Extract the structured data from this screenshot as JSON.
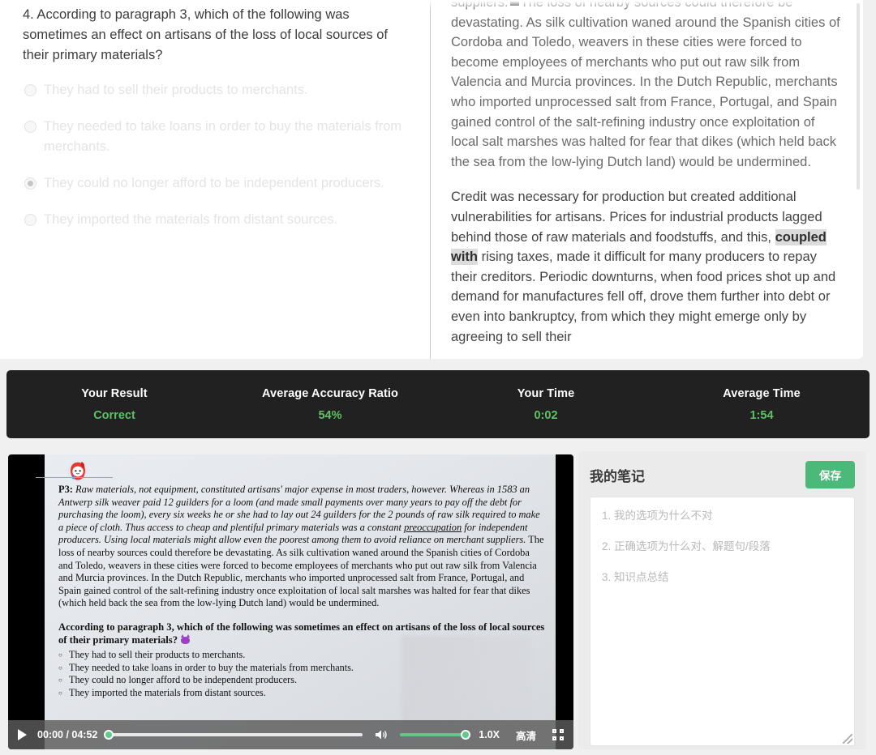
{
  "question": {
    "stem": "4. According to paragraph 3, which of the following was sometimes an effect on artisans of the loss of local sources of their primary materials?",
    "options": [
      {
        "text": "They had to sell their products to merchants.",
        "selected": false
      },
      {
        "text": "They needed to take loans in order to buy the materials from merchants.",
        "selected": false
      },
      {
        "text": "They could no longer afford to be independent producers.",
        "selected": true
      },
      {
        "text": "They imported the materials from distant sources.",
        "selected": false
      }
    ]
  },
  "passage": {
    "para1_pre": "suppliers.",
    "para1_post": "The loss of nearby sources could therefore be devastating. As silk cultivation waned around the Spanish cities of Cordoba and Toledo, weavers in these cities were forced to become employees of merchants who put out raw silk from Valencia and Murcia provinces. In the Dutch Republic, merchants who imported unprocessed salt from France, Portugal, and Spain gained control of the salt-refining industry once exploitation of local salt marshes was halted for fear that dikes (which held back the sea from the low-lying Dutch land) would be undermined.",
    "para2_a": "Credit was necessary for production but created additional vulnerabilities for artisans. Prices for industrial products lagged behind those of raw materials and foodstuffs, and this,",
    "para2_highlight": "coupled with",
    "para2_b": "rising taxes, made it difficult for many producers to repay their creditors. Periodic downturns, when food prices shot up and demand for manufactures fell off, drove them further into debt or even into bankruptcy, from which they might emerge only by agreeing to sell their"
  },
  "stats": {
    "accent_green": "#5dc264",
    "cells": [
      {
        "label": "Your Result",
        "value": "Correct"
      },
      {
        "label": "Average Accuracy Ratio",
        "value": "54%"
      },
      {
        "label": "Your Time",
        "value": "0:02"
      },
      {
        "label": "Average Time",
        "value": "1:54"
      }
    ]
  },
  "video": {
    "slide": {
      "para_label": "P3",
      "para_colon": ":",
      "italic_1": " Raw materials, not equipment, constituted artisans' major expense in most traders, however. Whereas in 1583 an Antwerp silk weaver paid 12 guilders for a loom (and made small payments over many years to pay off the debt for purchasing the loom), every six weeks he or she had to lay out 24 guilders for the 2 pounds of raw silk required to make a piece of cloth. Thus access to cheap and plentiful primary materials was a constant ",
      "underlined": "preoccupation",
      "italic_2": " for independent producers. Using local materials might allow even the poorest among them to avoid reliance on merchant suppliers.",
      "roman_rest": " The loss of nearby sources could therefore be devastating. As silk cultivation waned around the Spanish cities of Cordoba and Toledo, weavers in these cities were forced to become employees of merchants who put out raw silk from Valencia and Murcia provinces. In the Dutch Republic, merchants who imported unprocessed salt from France, Portugal, and Spain gained control of the salt-refining industry once exploitation of local salt marshes was halted for fear that dikes (which held back the sea from the low-lying Dutch land) would be undermined.",
      "question": "According to paragraph 3, which of the following was sometimes an effect on artisans of the loss of local sources of their primary materials?",
      "options": [
        "They had to sell their products to merchants.",
        "They needed to take loans in order to buy the materials from merchants.",
        "They could no longer afford to be independent producers.",
        "They imported the materials from distant sources."
      ]
    },
    "controls": {
      "time": "00:00 / 04:52",
      "speed": "1.0X",
      "quality": "高清",
      "progress_percent": 0,
      "volume_percent": 100
    }
  },
  "notes": {
    "title": "我的笔记",
    "save_label": "保存",
    "placeholders": [
      "1. 我的选项为什么不对",
      "2. 正确选项为什么对、解题句/段落",
      "3. 知识点总结"
    ]
  }
}
